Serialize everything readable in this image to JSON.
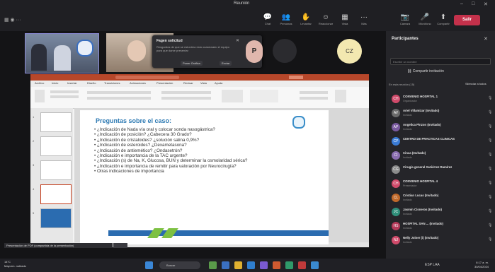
{
  "window": {
    "title": "Reunión"
  },
  "window_controls": {
    "minimize": "–",
    "maximize": "□",
    "close": "✕"
  },
  "toolbar": {
    "buttons": [
      {
        "label": "Chat",
        "icon": "💬"
      },
      {
        "label": "Personas",
        "icon": "👥"
      },
      {
        "label": "Levantar",
        "icon": "✋"
      },
      {
        "label": "Reaccionar",
        "icon": "☺"
      },
      {
        "label": "Vista",
        "icon": "▦"
      },
      {
        "label": "Más",
        "icon": "···"
      },
      {
        "label": "Cámara",
        "icon": "📷"
      },
      {
        "label": "Micrófono",
        "icon": "🎤"
      },
      {
        "label": "Compartir",
        "icon": "⬆"
      }
    ],
    "leave_label": "Salir"
  },
  "notification": {
    "heading": "Fagen solicitud",
    "body": "Resgurdos de que se estuviera esto ocasionado el equipo para que darse presentar",
    "action1": "Poner Gráfica",
    "action2": "Enviar"
  },
  "video_strip": {
    "avatar_p": "P",
    "avatar_cz": "CZ"
  },
  "ppt": {
    "tabs": [
      "Archivo",
      "Inicio",
      "Insertar",
      "Diseño",
      "Transiciones",
      "Animaciones",
      "Presentación",
      "Revisar",
      "Vista",
      "Ayuda"
    ],
    "slide_count": 5,
    "slide": {
      "title": "Preguntas sobre el caso:",
      "bullets": [
        "• ¿Indicación de Nada vía oral y colocar sonda nasogástrica?",
        "• ¿Indicación de posición? ¿Cabecera 30 Grado?",
        "• ¿Indicación de cristaloides? ¿solución salina 0,9%?",
        "• ¿Indicación de esteroides? ¿Dexametasona?",
        "• ¿Indicación de antiemético? ¿Ondasetrón?",
        "• ¿Indicación e importancia de la TAC urgente?",
        "• ¿Indicación (s) de Na, K, Glucosa, BUN y determinar la osmolaridad sérica?",
        "• ¿Indicación e importancia de remitir para valoración por Neurocirugía?",
        "• Otras indicaciones de importancia"
      ]
    }
  },
  "share_caption": "Presentación de PDF (compartida de la presentación)",
  "panel": {
    "title": "Participantes",
    "search_placeholder": "Escribir un nombre",
    "invite_label": "Compartir invitación",
    "section_label": "En esta reunión (15)",
    "mute_all": "Silenciar a todos",
    "participants": [
      {
        "name": "CONVENIO HOSPITAL 1",
        "role": "Organizador",
        "initials": "CH",
        "color": "#d04a6a"
      },
      {
        "name": "Ariel Villamizar (Invitado)",
        "role": "Invitado",
        "initials": "AV",
        "color": "#6b6b6b"
      },
      {
        "name": "Angelica Pinzon (Invitado)",
        "role": "Invitado",
        "initials": "AP",
        "color": "#7a5aa0"
      },
      {
        "name": "CENTRO DE PRACTICAS CLINICAS",
        "role": "Organizador",
        "initials": "CP",
        "color": "#3a7bd5"
      },
      {
        "name": "Cinca (Invitado)",
        "role": "Invitado",
        "initials": "CI",
        "color": "#8a6db0"
      },
      {
        "name": "Cirugía general Gutiérrez Ramírez",
        "role": "Invitado",
        "initials": "CG",
        "color": "#8c8c8c"
      },
      {
        "name": "CONVENIO HOSPITAL 4",
        "role": "Presentador",
        "initials": "CH",
        "color": "#d04a6a"
      },
      {
        "name": "Cristian Lucas (Invitado)",
        "role": "Invitado",
        "initials": "CL",
        "color": "#c0692a"
      },
      {
        "name": "Jasmin Cisneros (Invitado)",
        "role": "Invitado",
        "initials": "JC",
        "color": "#2f8f7a"
      },
      {
        "name": "HOSPITAL SAN ... (Invitado)",
        "role": "Invitado",
        "initials": "HS",
        "color": "#b53a5a"
      },
      {
        "name": "Nelly Joiner (i) (Invitado)",
        "role": "Invitado",
        "initials": "NJ",
        "color": "#d04a6a"
      }
    ]
  },
  "taskbar": {
    "weather_temp": "14°C",
    "weather_desc": "Mayorm. nublado",
    "search_label": "Buscar",
    "lang": "ESP LAA",
    "time": "8:17 a. m.",
    "date": "30/04/2024"
  }
}
